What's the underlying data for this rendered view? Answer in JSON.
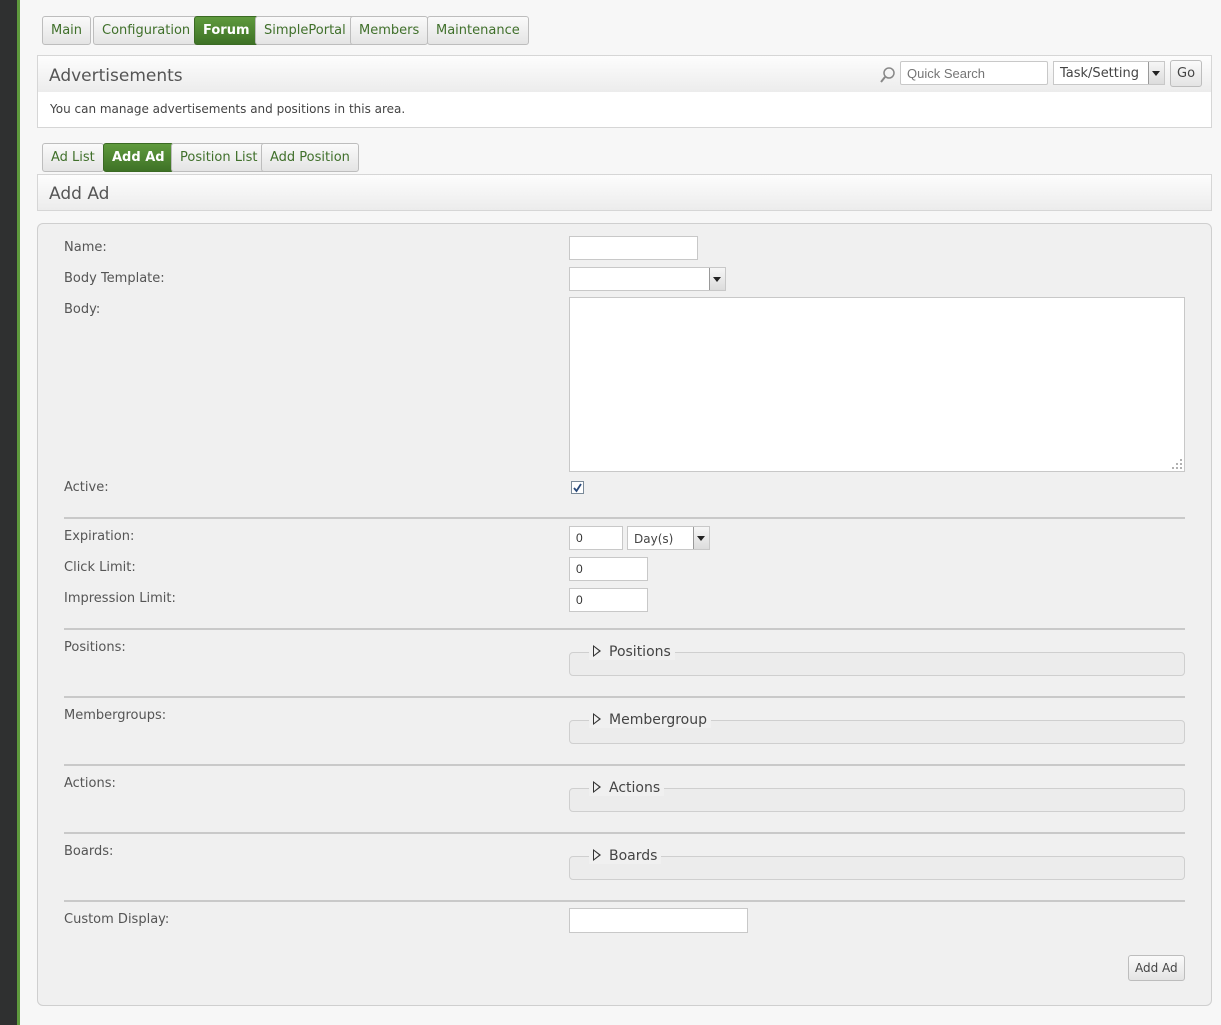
{
  "top_tabs": [
    {
      "label": "Main",
      "active": false
    },
    {
      "label": "Configuration",
      "active": false
    },
    {
      "label": "Forum",
      "active": true
    },
    {
      "label": "SimplePortal",
      "active": false
    },
    {
      "label": "Members",
      "active": false
    },
    {
      "label": "Maintenance",
      "active": false
    }
  ],
  "header": {
    "title": "Advertisements",
    "description": "You can manage advertisements and positions in this area.",
    "search_placeholder": "Quick Search",
    "search_scope": "Task/Setting",
    "go_label": "Go",
    "search_icon": "magnifier-icon"
  },
  "sub_tabs": [
    {
      "label": "Ad List",
      "active": false
    },
    {
      "label": "Add Ad",
      "active": true
    },
    {
      "label": "Position List",
      "active": false
    },
    {
      "label": "Add Position",
      "active": false
    }
  ],
  "section_title": "Add Ad",
  "form": {
    "name_label": "Name:",
    "name_value": "",
    "body_template_label": "Body Template:",
    "body_template_value": "",
    "body_label": "Body:",
    "active_label": "Active:",
    "active_checked": true,
    "expiration_label": "Expiration:",
    "expiration_value": "0",
    "expiration_unit": "Day(s)",
    "click_limit_label": "Click Limit:",
    "click_limit_value": "0",
    "impression_limit_label": "Impression Limit:",
    "impression_limit_value": "0",
    "positions_label": "Positions:",
    "positions_legend": "Positions",
    "membergroups_label": "Membergroups:",
    "membergroups_legend": "Membergroup",
    "actions_label": "Actions:",
    "actions_legend": "Actions",
    "boards_label": "Boards:",
    "boards_legend": "Boards",
    "custom_display_label": "Custom Display:",
    "custom_display_value": "",
    "submit_label": "Add Ad"
  },
  "colors": {
    "accent": "#4a8532",
    "sidebar": "#2f3030"
  }
}
